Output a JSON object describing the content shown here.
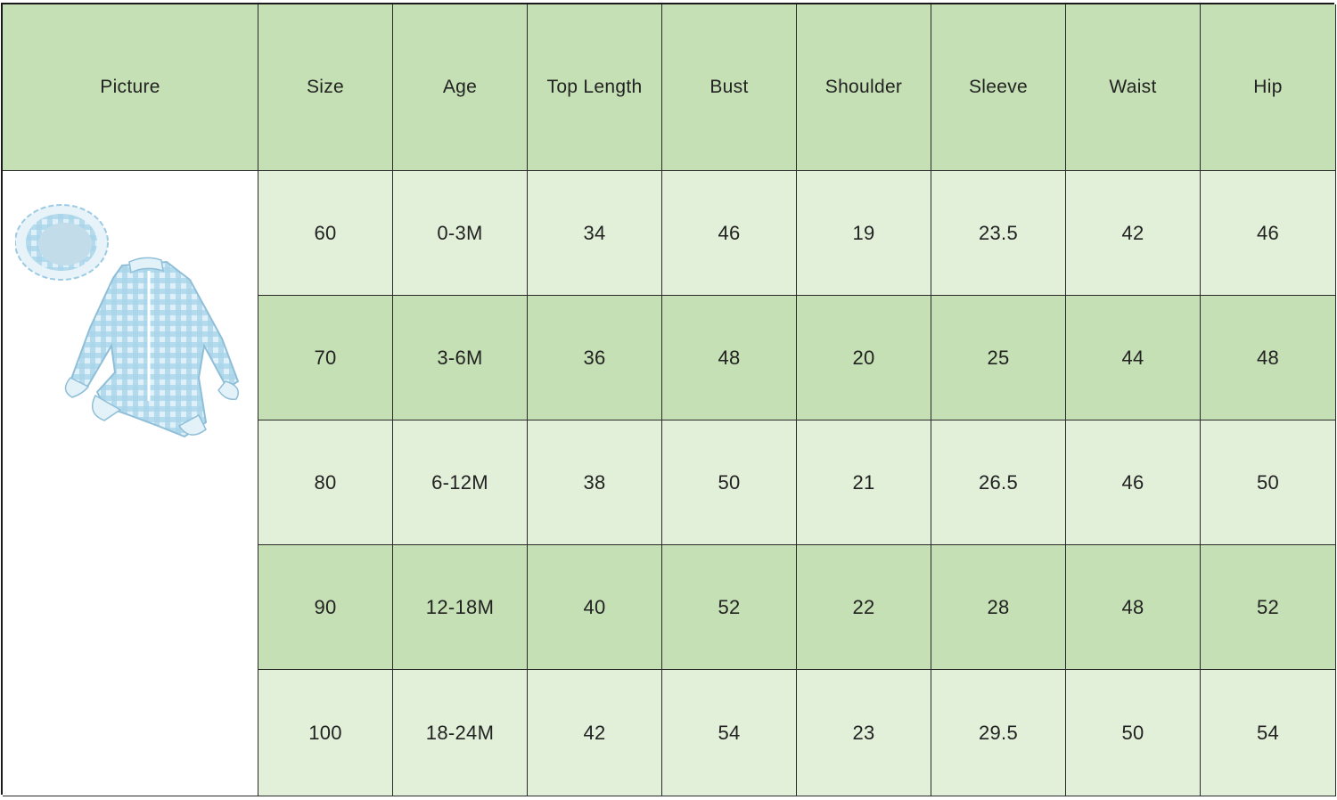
{
  "table": {
    "headers": [
      "Picture",
      "Size",
      "Age",
      "Top Length",
      "Bust",
      "Shoulder",
      "Sleeve",
      "Waist",
      "Hip"
    ],
    "rows": [
      [
        "60",
        "0-3M",
        "34",
        "46",
        "19",
        "23.5",
        "42",
        "46"
      ],
      [
        "70",
        "3-6M",
        "36",
        "48",
        "20",
        "25",
        "44",
        "48"
      ],
      [
        "80",
        "6-12M",
        "38",
        "50",
        "21",
        "26.5",
        "46",
        "50"
      ],
      [
        "90",
        "12-18M",
        "40",
        "52",
        "22",
        "28",
        "48",
        "52"
      ],
      [
        "100",
        "18-24M",
        "42",
        "54",
        "23",
        "29.5",
        "50",
        "54"
      ]
    ]
  },
  "picture": {
    "icon": "baby-swimsuit-with-hat-image",
    "color": "#a9d4ea"
  },
  "colors": {
    "header_bg": "#c5e0b4",
    "row_light": "#e2f0d9",
    "row_dark": "#c5e0b4",
    "border": "#2a2a2a"
  }
}
